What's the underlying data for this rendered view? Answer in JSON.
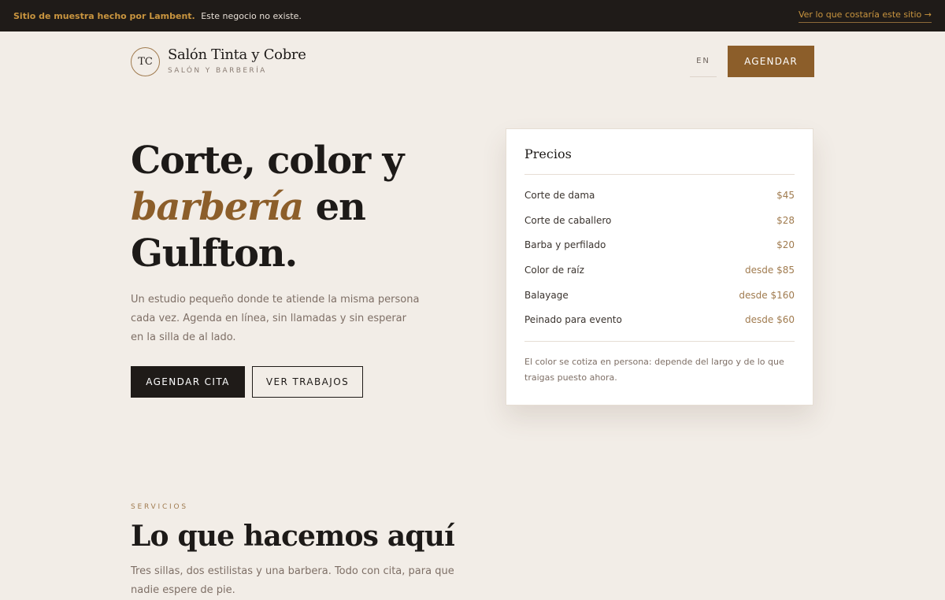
{
  "banner": {
    "brand": "Sitio de muestra hecho por Lambent.",
    "note": "Este negocio no existe.",
    "cta": "Ver lo que costaría este sitio →"
  },
  "header": {
    "logo_initials": "TC",
    "name": "Salón Tinta y Cobre",
    "tagline": "SALÓN Y BARBERÍA",
    "lang": "EN",
    "book": "AGENDAR"
  },
  "hero": {
    "title_line1": "Corte, color y",
    "title_accent": "barbería",
    "title_line2_rest": " en",
    "title_line3": "Gulfton.",
    "subtitle": "Un estudio pequeño donde te atiende la misma persona cada vez. Agenda en línea, sin llamadas y sin esperar en la silla de al lado.",
    "primary_btn": "AGENDAR CITA",
    "secondary_btn": "VER TRABAJOS"
  },
  "prices": {
    "title": "Precios",
    "items": [
      {
        "name": "Corte de dama",
        "price": "$45"
      },
      {
        "name": "Corte de caballero",
        "price": "$28"
      },
      {
        "name": "Barba y perfilado",
        "price": "$20"
      },
      {
        "name": "Color de raíz",
        "price": "desde $85"
      },
      {
        "name": "Balayage",
        "price": "desde $160"
      },
      {
        "name": "Peinado para evento",
        "price": "desde $60"
      }
    ],
    "note": "El color se cotiza en persona: depende del largo y de lo que traigas puesto ahora."
  },
  "services": {
    "label": "SERVICIOS",
    "title": "Lo que hacemos aquí",
    "subtitle": "Tres sillas, dos estilistas y una barbera. Todo con cita, para que nadie espere de pie."
  },
  "colors": {
    "accent": "#8c5e2a",
    "dark": "#1f1b18",
    "background": "#f2ede7"
  }
}
